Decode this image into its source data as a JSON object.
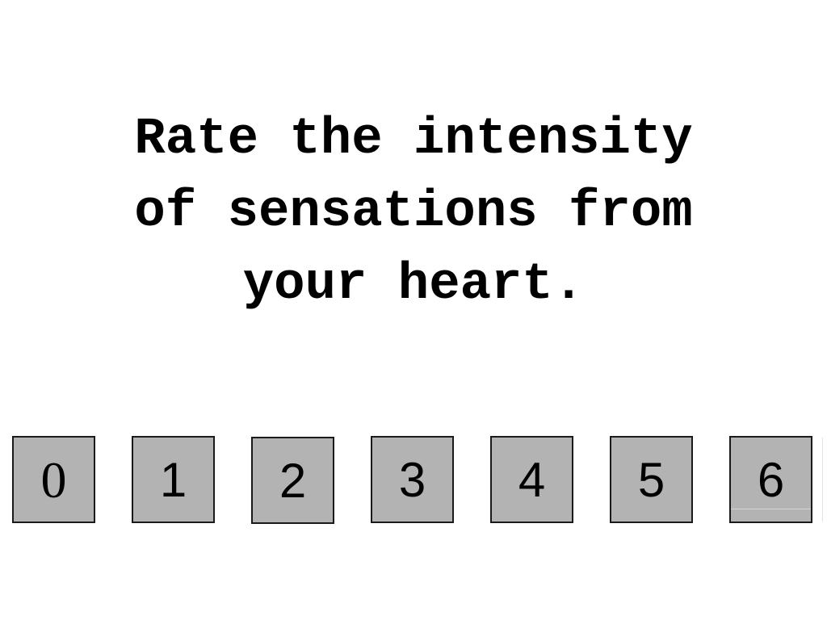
{
  "prompt": {
    "text": "Rate the intensity\nof sensations from\nyour heart."
  },
  "scale": {
    "options": [
      {
        "label": "0"
      },
      {
        "label": "1"
      },
      {
        "label": "2"
      },
      {
        "label": "3"
      },
      {
        "label": "4"
      },
      {
        "label": "5"
      },
      {
        "label": "6"
      }
    ],
    "colors": {
      "button_fill": "#b3b3b3",
      "button_border": "#1a1a1a",
      "text": "#000000",
      "background": "#ffffff"
    }
  }
}
